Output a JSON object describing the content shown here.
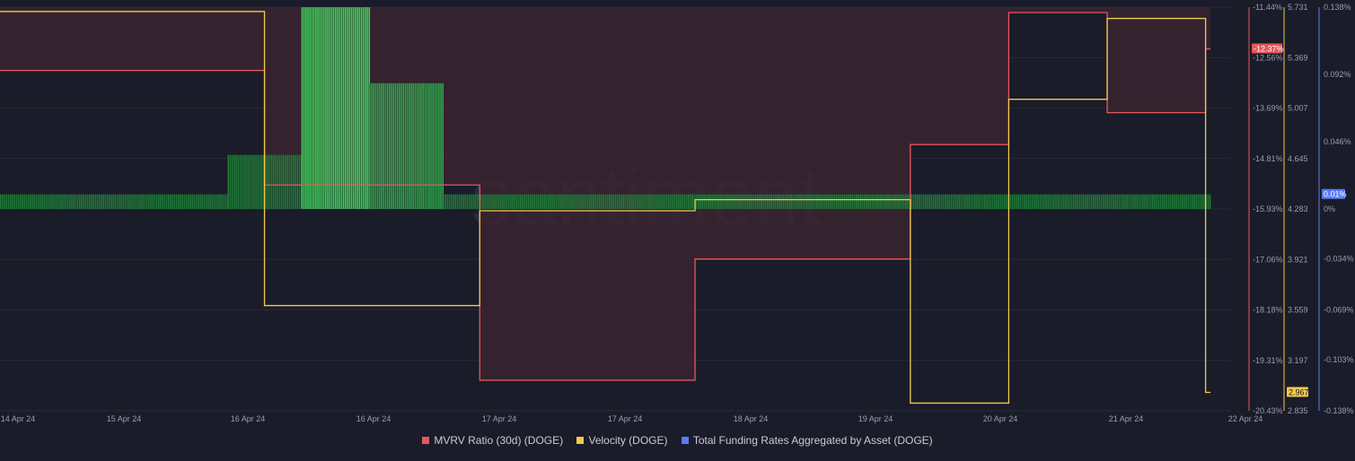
{
  "chart_data": {
    "type": "line",
    "watermark": "santiment",
    "x_tick_labels": [
      "14 Apr 24",
      "15 Apr 24",
      "16 Apr 24",
      "16 Apr 24",
      "17 Apr 24",
      "17 Apr 24",
      "18 Apr 24",
      "19 Apr 24",
      "20 Apr 24",
      "21 Apr 24",
      "22 Apr 24"
    ],
    "axes": {
      "mvrv": {
        "ylim": [
          -20.43,
          -11.44
        ],
        "ticks": [
          "-11.44%",
          "-12.56%",
          "-13.69%",
          "-14.81%",
          "-15.93%",
          "-17.06%",
          "-18.18%",
          "-19.31%",
          "-20.43%"
        ],
        "current_label": "-12.37%",
        "color": "#e8565b"
      },
      "velocity": {
        "ylim": [
          2.835,
          5.731
        ],
        "ticks": [
          "5.731",
          "5.369",
          "5.007",
          "4.645",
          "4.283",
          "3.921",
          "3.559",
          "3.197",
          "2.835"
        ],
        "current_label": "2.967",
        "color": "#f2c94c"
      },
      "funding": {
        "ylim": [
          -0.138,
          0.138
        ],
        "ticks": [
          "0.138%",
          "0.092%",
          "0.046%",
          "0%",
          "-0.034%",
          "-0.069%",
          "-0.103%",
          "-0.138%"
        ],
        "current_label": "0.01%",
        "color": "#5a7bf2"
      }
    },
    "series": [
      {
        "name": "MVRV Ratio (30d) (DOGE)",
        "color": "#e8565b",
        "x": [
          0,
          2.15,
          2.15,
          3.9,
          3.9,
          5.65,
          5.65,
          7.4,
          7.4,
          8.2,
          8.2,
          9.0,
          9.0,
          9.8,
          9.8,
          9.84
        ],
        "values": [
          -12.85,
          -12.85,
          -15.4,
          -15.4,
          -19.75,
          -19.75,
          -17.05,
          -17.05,
          -14.5,
          -14.5,
          -11.56,
          -11.56,
          -13.79,
          -13.79,
          -12.37,
          -12.37
        ]
      },
      {
        "name": "Velocity (DOGE)",
        "color": "#f2c94c",
        "x": [
          0,
          2.15,
          2.15,
          3.9,
          3.9,
          5.65,
          5.65,
          7.4,
          7.4,
          8.2,
          8.2,
          9.0,
          9.0,
          9.8,
          9.8,
          9.84
        ],
        "values": [
          5.7,
          5.7,
          3.59,
          3.59,
          4.27,
          4.27,
          4.35,
          4.35,
          2.89,
          2.89,
          5.07,
          5.07,
          5.65,
          5.65,
          2.967,
          2.967
        ]
      },
      {
        "name": "Total Funding Rates Aggregated by Asset (DOGE)",
        "color": "#5a7bf2",
        "segments": [
          {
            "x": [
              0,
              1.85
            ],
            "value": 0.01
          },
          {
            "x": [
              1.85,
              2.45
            ],
            "value": 0.037
          },
          {
            "x": [
              2.45,
              3.0
            ],
            "value": 0.138
          },
          {
            "x": [
              3.0,
              3.6
            ],
            "value": 0.086
          },
          {
            "x": [
              3.6,
              9.84
            ],
            "value": 0.01
          }
        ]
      }
    ],
    "legend_placement": "bottom-center"
  },
  "legend": [
    {
      "label": "MVRV Ratio (30d) (DOGE)",
      "color": "#e8565b"
    },
    {
      "label": "Velocity (DOGE)",
      "color": "#f2c94c"
    },
    {
      "label": "Total Funding Rates Aggregated by Asset (DOGE)",
      "color": "#5a7bf2"
    }
  ]
}
